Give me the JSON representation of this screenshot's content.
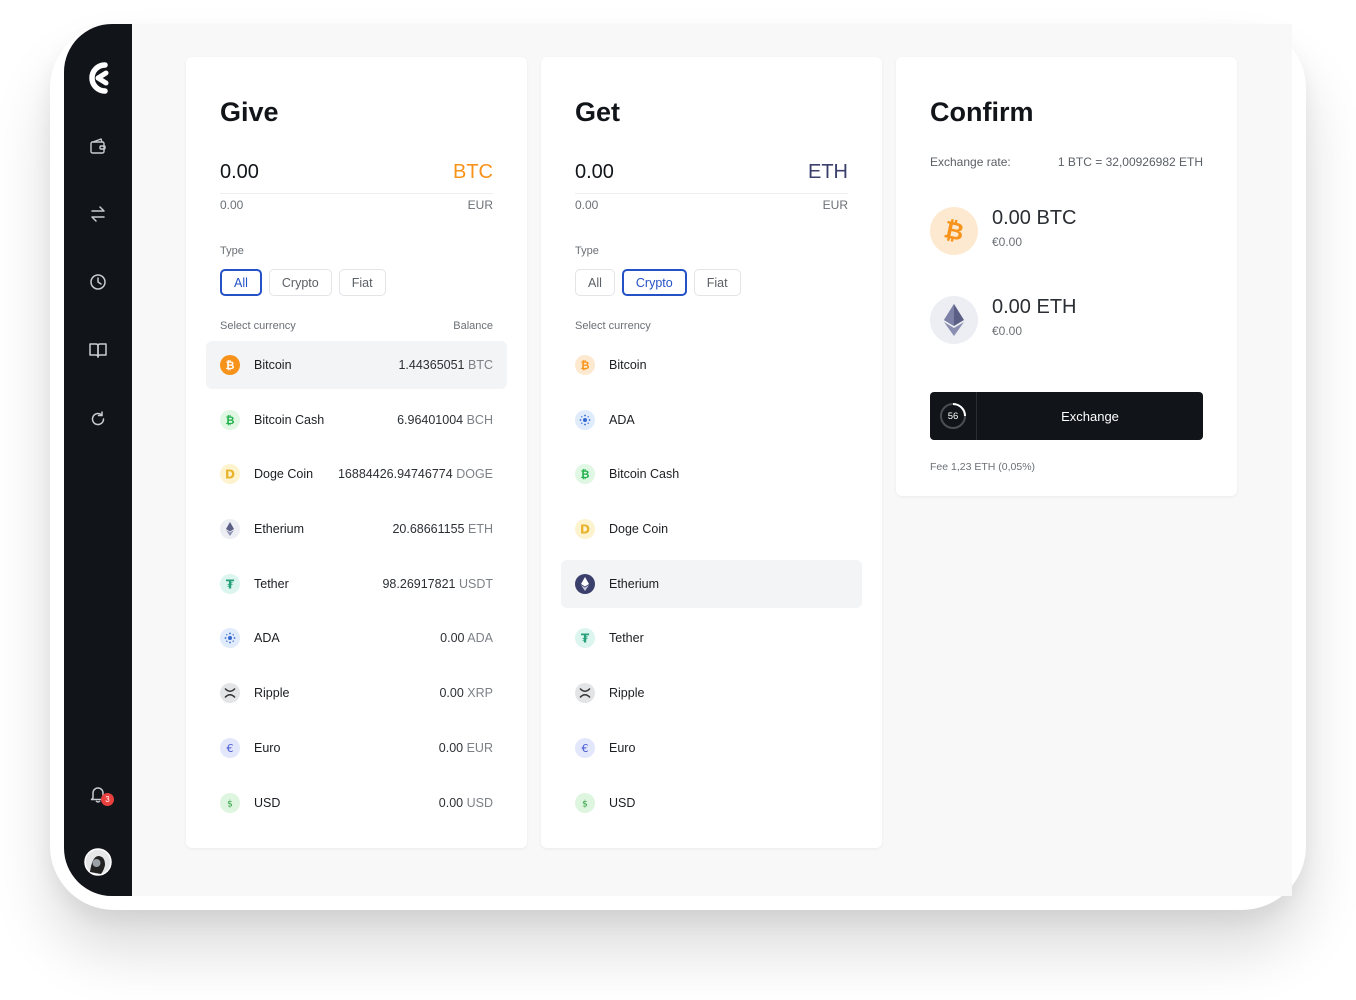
{
  "brand": {
    "logo": "c-logo-icon"
  },
  "sidebar": {
    "items": [
      {
        "icon": "wallet-icon"
      },
      {
        "icon": "swap-arrows-icon"
      },
      {
        "icon": "clock-icon"
      },
      {
        "icon": "book-icon"
      },
      {
        "icon": "refresh-icon"
      }
    ],
    "notifications": {
      "icon": "bell-icon",
      "count": "3"
    },
    "profile": {
      "icon": "avatar-icon"
    }
  },
  "colors": {
    "accent": "#2451c6",
    "btc": "#f7931a",
    "eth": "#3b3f6b",
    "sidebar": "#111418"
  },
  "give": {
    "title": "Give",
    "amount": "0.00",
    "currency": "BTC",
    "sub_amount": "0.00",
    "sub_currency": "EUR",
    "type_label": "Type",
    "filters": [
      "All",
      "Crypto",
      "Fiat"
    ],
    "active_filter": "All",
    "select_label": "Select currency",
    "balance_label": "Balance",
    "rows": [
      {
        "name": "Bitcoin",
        "amount": "1.44365051",
        "unit": "BTC",
        "icon": "bitcoin-icon"
      },
      {
        "name": "Bitcoin Cash",
        "amount": "6.96401004",
        "unit": "BCH",
        "icon": "bitcoin-cash-icon"
      },
      {
        "name": "Doge Coin",
        "amount": "16884426.94746774",
        "unit": "DOGE",
        "icon": "doge-icon"
      },
      {
        "name": "Etherium",
        "amount": "20.68661155",
        "unit": "ETH",
        "icon": "ethereum-icon"
      },
      {
        "name": "Tether",
        "amount": "98.26917821",
        "unit": "USDT",
        "icon": "tether-icon"
      },
      {
        "name": "ADA",
        "amount": "0.00",
        "unit": "ADA",
        "icon": "ada-icon"
      },
      {
        "name": "Ripple",
        "amount": "0.00",
        "unit": "XRP",
        "icon": "ripple-icon"
      },
      {
        "name": "Euro",
        "amount": "0.00",
        "unit": "EUR",
        "icon": "euro-icon"
      },
      {
        "name": "USD",
        "amount": "0.00",
        "unit": "USD",
        "icon": "usd-icon"
      }
    ]
  },
  "get": {
    "title": "Get",
    "amount": "0.00",
    "currency": "ETH",
    "sub_amount": "0.00",
    "sub_currency": "EUR",
    "type_label": "Type",
    "filters": [
      "All",
      "Crypto",
      "Fiat"
    ],
    "active_filter": "Crypto",
    "select_label": "Select currency",
    "rows": [
      {
        "name": "Bitcoin",
        "icon": "bitcoin-icon"
      },
      {
        "name": "ADA",
        "icon": "ada-icon"
      },
      {
        "name": "Bitcoin Cash",
        "icon": "bitcoin-cash-icon"
      },
      {
        "name": "Doge Coin",
        "icon": "doge-icon"
      },
      {
        "name": "Etherium",
        "icon": "ethereum-icon"
      },
      {
        "name": "Tether",
        "icon": "tether-icon"
      },
      {
        "name": "Ripple",
        "icon": "ripple-icon"
      },
      {
        "name": "Euro",
        "icon": "euro-icon"
      },
      {
        "name": "USD",
        "icon": "usd-icon"
      }
    ]
  },
  "confirm": {
    "title": "Confirm",
    "rate_label": "Exchange rate:",
    "rate_value": "1 BTC = 32,00926982 ETH",
    "give_amount": "0.00 BTC",
    "give_fiat": "€0.00",
    "get_amount": "0.00 ETH",
    "get_fiat": "€0.00",
    "timer": "56",
    "button_label": "Exchange",
    "fee": "Fee 1,23 ETH (0,05%)"
  }
}
